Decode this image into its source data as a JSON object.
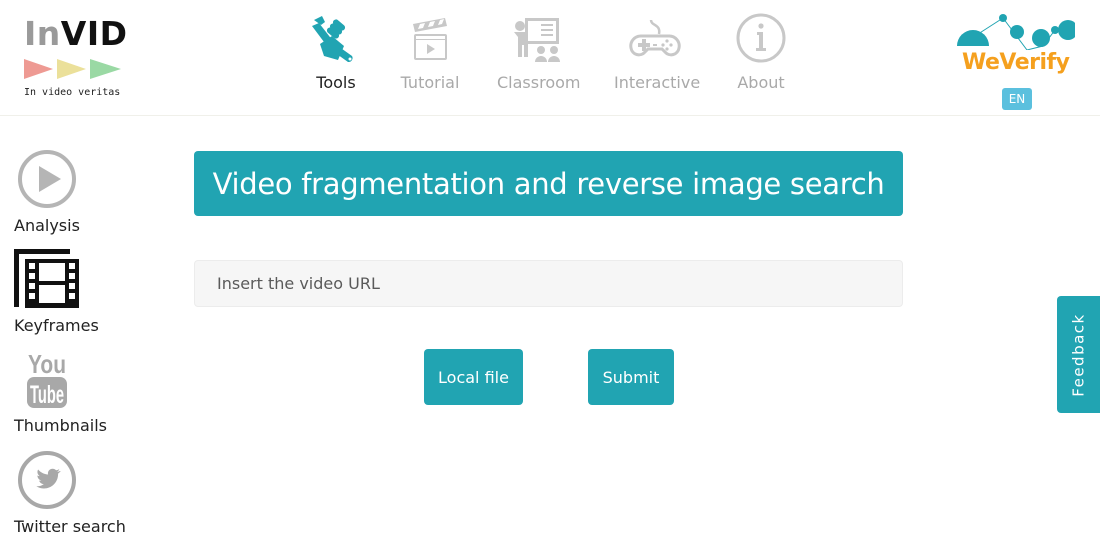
{
  "logo": {
    "part1": "In",
    "part2": "VID",
    "tagline": "In video veritas",
    "triangle_colors": [
      "#ee9a93",
      "#ebe09a",
      "#9ad9a4"
    ]
  },
  "nav": {
    "items": [
      {
        "label": "Tools",
        "icon": "wrench-hand-icon",
        "active": true
      },
      {
        "label": "Tutorial",
        "icon": "clapperboard-icon",
        "active": false
      },
      {
        "label": "Classroom",
        "icon": "classroom-icon",
        "active": false
      },
      {
        "label": "Interactive",
        "icon": "gamepad-icon",
        "active": false
      },
      {
        "label": "About",
        "icon": "info-icon",
        "active": false
      }
    ]
  },
  "brand": {
    "name": "WeVerify",
    "language": "EN"
  },
  "sidebar": {
    "items": [
      {
        "label": "Analysis",
        "icon": "play-circle-icon"
      },
      {
        "label": "Keyframes",
        "icon": "film-frames-icon"
      },
      {
        "label": "Thumbnails",
        "icon": "youtube-icon"
      },
      {
        "label": "Twitter search",
        "icon": "twitter-icon"
      }
    ]
  },
  "main": {
    "title": "Video fragmentation and reverse image search",
    "url_input": {
      "value": "",
      "placeholder": "Insert the video URL"
    },
    "local_file_label": "Local file",
    "submit_label": "Submit"
  },
  "feedback": {
    "label": "Feedback"
  },
  "colors": {
    "accent": "#21a4b2",
    "inactive_icon": "#c8c8c8",
    "brand_orange": "#f5a01e",
    "lang_badge": "#5bc0de"
  }
}
